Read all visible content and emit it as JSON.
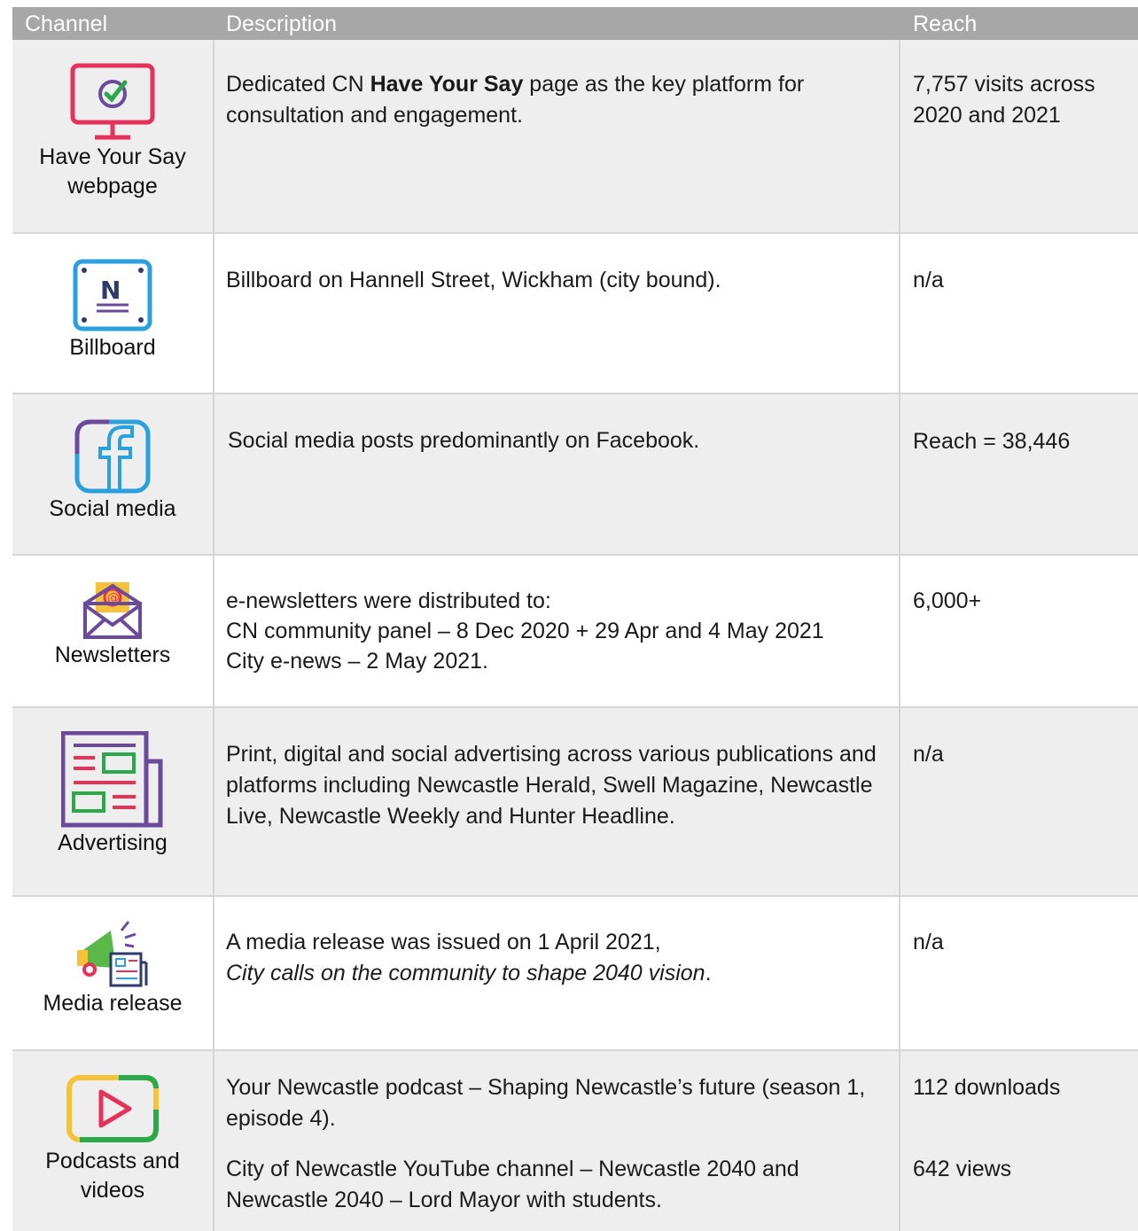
{
  "header": {
    "channel": "Channel",
    "description": "Description",
    "reach": "Reach"
  },
  "rows": [
    {
      "channel": "Have Your Say webpage",
      "icon": "monitor-check-icon",
      "desc_pre": "Dedicated CN ",
      "desc_bold": "Have Your Say",
      "desc_post": " page as the key platform for consultation and engagement.",
      "reach": "7,757 visits across 2020 and 2021"
    },
    {
      "channel": "Billboard",
      "icon": "billboard-icon",
      "desc": "Billboard on Hannell Street, Wickham (city bound).",
      "reach": "n/a"
    },
    {
      "channel": "Social media",
      "icon": "facebook-icon",
      "desc": "Social media posts predominantly on Facebook.",
      "reach": "Reach = 38,446"
    },
    {
      "channel": "Newsletters",
      "icon": "email-envelope-icon",
      "desc1": "e-newsletters were distributed to:",
      "desc2": "CN community panel – 8 Dec 2020 + 29 Apr and 4 May 2021",
      "desc3": "City e-news – 2 May 2021.",
      "reach": "6,000+"
    },
    {
      "channel": "Advertising",
      "icon": "newspaper-icon",
      "desc": "Print, digital and social advertising across various publications and platforms including Newcastle Herald, Swell Magazine, Newcastle Live, Newcastle Weekly and Hunter Headline.",
      "reach": "n/a"
    },
    {
      "channel": "Media release",
      "icon": "megaphone-icon",
      "desc1": "A media release was issued on 1 April 2021,",
      "desc2": "City calls on the community to shape 2040 vision",
      "desc2_end": ".",
      "reach": "n/a"
    },
    {
      "channel": "Podcasts and videos",
      "icon": "play-button-icon",
      "desc1": "Your Newcastle podcast – Shaping Newcastle’s future (season 1, episode 4).",
      "reach1": "112 downloads",
      "desc2": "City of Newcastle YouTube channel – Newcastle 2040 and Newcastle 2040 – Lord Mayor with students.",
      "reach2": "642 views"
    }
  ]
}
